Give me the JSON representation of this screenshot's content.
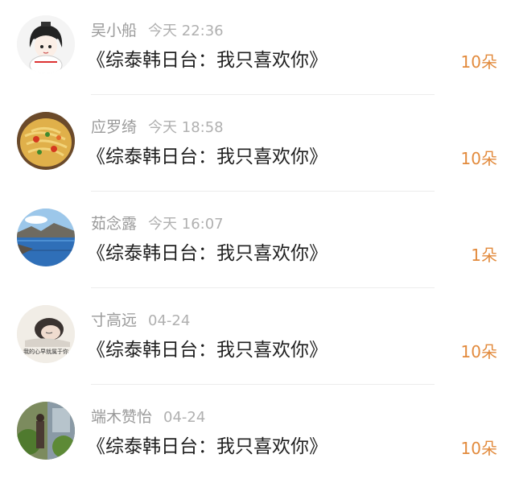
{
  "items": [
    {
      "user": "吴小船",
      "time": "今天 22:36",
      "title": "《综泰韩日台：我只喜欢你》",
      "count": "10朵",
      "avatar_icon": "anime-girl-avatar-icon"
    },
    {
      "user": "应罗绮",
      "time": "今天 18:58",
      "title": "《综泰韩日台：我只喜欢你》",
      "count": "10朵",
      "avatar_icon": "food-noodles-avatar-icon"
    },
    {
      "user": "茹念露",
      "time": "今天 16:07",
      "title": "《综泰韩日台：我只喜欢你》",
      "count": "1朵",
      "avatar_icon": "lake-landscape-avatar-icon"
    },
    {
      "user": "寸高远",
      "time": "04-24",
      "title": "《综泰韩日台：我只喜欢你》",
      "count": "10朵",
      "avatar_icon": "sleeping-girl-avatar-icon",
      "avatar_text": "我的心早就属于你"
    },
    {
      "user": "端木赞怡",
      "time": "04-24",
      "title": "《综泰韩日台：我只喜欢你》",
      "count": "10朵",
      "avatar_icon": "garden-photo-avatar-icon"
    }
  ],
  "colors": {
    "count": "#e28a3c",
    "meta": "#9a9a9a",
    "title": "#1f1f1f"
  }
}
